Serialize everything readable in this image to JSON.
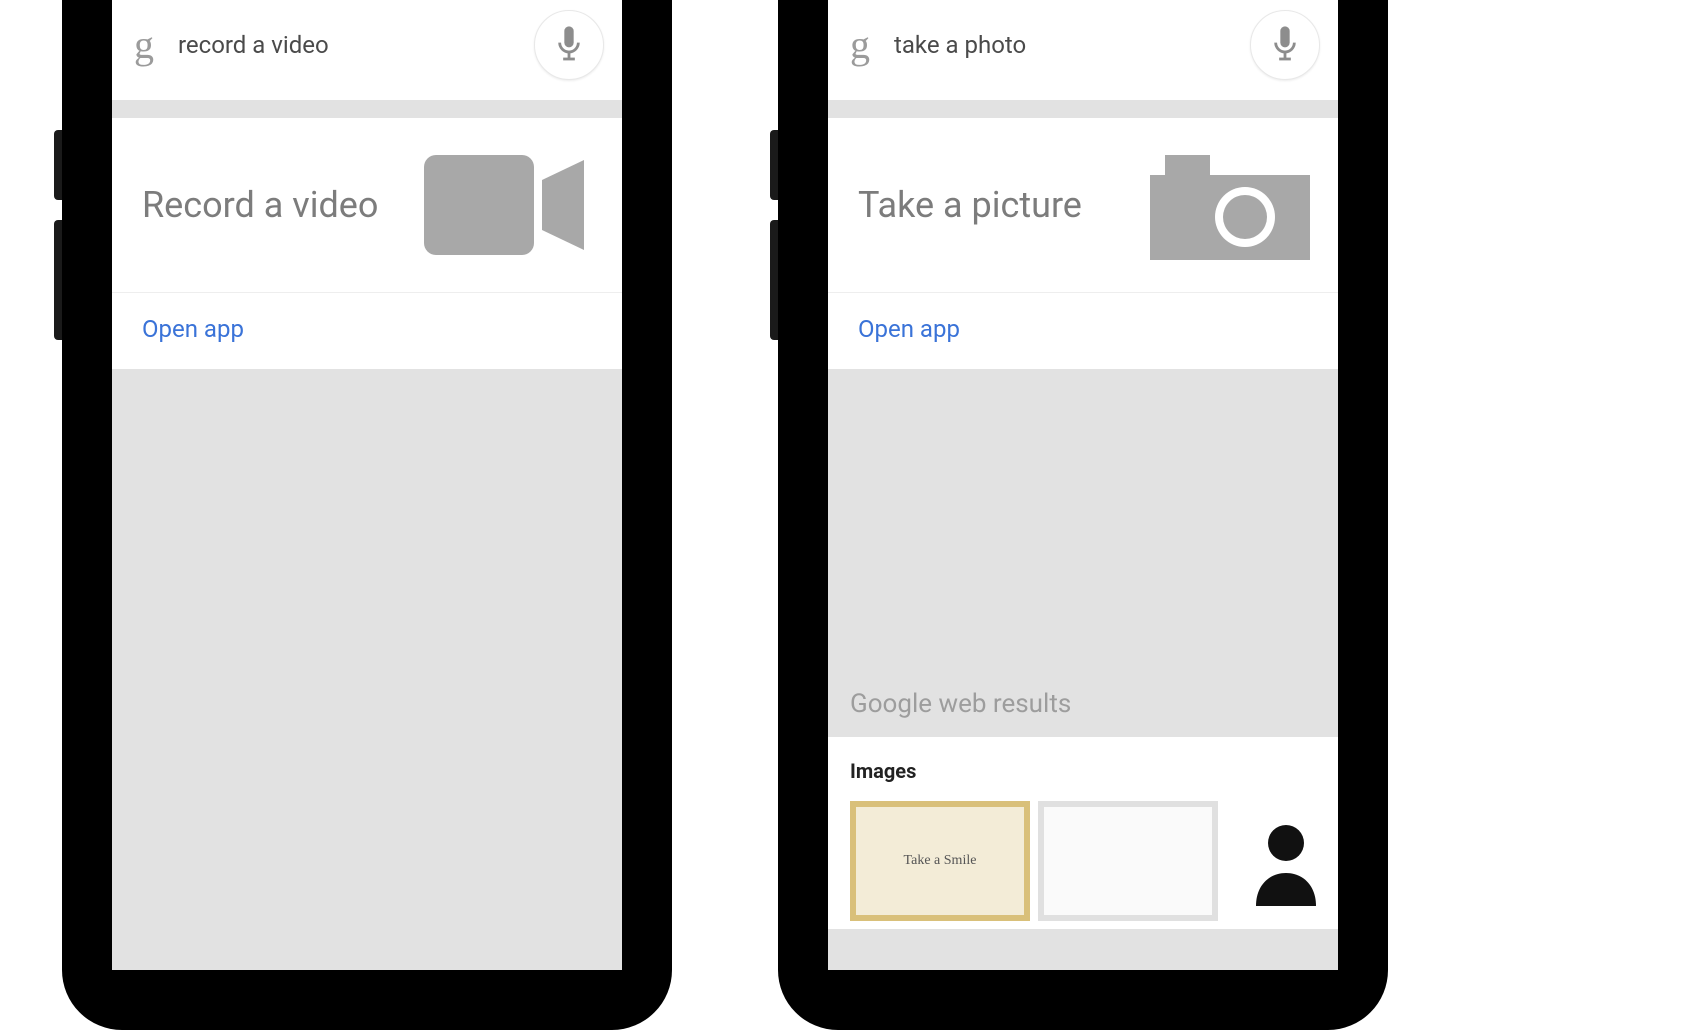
{
  "phones": [
    {
      "search": {
        "query": "record a video"
      },
      "card": {
        "title": "Record a video",
        "action": "Open app",
        "icon": "video"
      }
    },
    {
      "search": {
        "query": "take a photo"
      },
      "card": {
        "title": "Take a picture",
        "action": "Open app",
        "icon": "camera"
      },
      "results": {
        "section_label": "Google web results",
        "heading": "Images"
      }
    }
  ],
  "icons": {
    "g_glyph": "g",
    "thumb1_caption": "Take a Smile"
  }
}
